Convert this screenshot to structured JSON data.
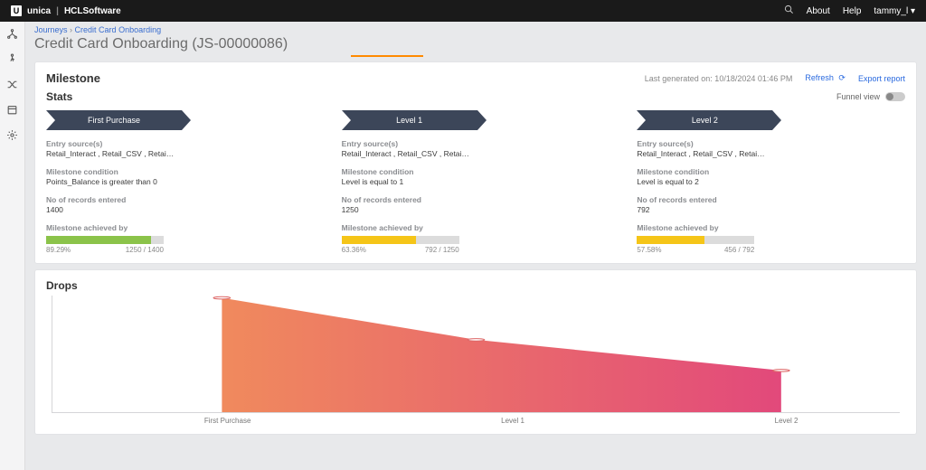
{
  "topbar": {
    "brand_primary": "unica",
    "brand_separator": "|",
    "brand_secondary_bold": "HCL",
    "brand_secondary_light": "Software",
    "links": {
      "about": "About",
      "help": "Help",
      "user": "tammy_l"
    }
  },
  "breadcrumb": {
    "root": "Journeys",
    "current": "Credit Card Onboarding"
  },
  "page": {
    "title": "Credit Card Onboarding (JS-00000086)"
  },
  "milestone": {
    "title": "Milestone",
    "last_generated": "Last generated on: 10/18/2024 01:46 PM",
    "refresh": "Refresh",
    "export": "Export report"
  },
  "stats": {
    "title": "Stats",
    "funnel_label": "Funnel view",
    "columns": [
      {
        "name": "First Purchase",
        "entry_label": "Entry source(s)",
        "entry_value": "Retail_Interact , Retail_CSV , Retai…",
        "condition_label": "Milestone condition",
        "condition_value": "Points_Balance is greater than 0",
        "records_label": "No of records entered",
        "records_value": "1400",
        "achieved_label": "Milestone achieved by",
        "percent": "89.29%",
        "ratio": "1250 / 1400",
        "fill_pct": 89.29,
        "color": "green"
      },
      {
        "name": "Level 1",
        "entry_label": "Entry source(s)",
        "entry_value": "Retail_Interact , Retail_CSV , Retai…",
        "condition_label": "Milestone condition",
        "condition_value": "Level is equal to 1",
        "records_label": "No of records entered",
        "records_value": "1250",
        "achieved_label": "Milestone achieved by",
        "percent": "63.36%",
        "ratio": "792 / 1250",
        "fill_pct": 63.36,
        "color": "yellow"
      },
      {
        "name": "Level 2",
        "entry_label": "Entry source(s)",
        "entry_value": "Retail_Interact , Retail_CSV , Retai…",
        "condition_label": "Milestone condition",
        "condition_value": "Level is equal to 2",
        "records_label": "No of records entered",
        "records_value": "792",
        "achieved_label": "Milestone achieved by",
        "percent": "57.58%",
        "ratio": "456 / 792",
        "fill_pct": 57.58,
        "color": "yellow"
      }
    ]
  },
  "drops": {
    "title": "Drops",
    "series": [
      {
        "label": "First Purchase",
        "value": 1250
      },
      {
        "label": "Level 1",
        "value": 792
      },
      {
        "label": "Level 2",
        "value": 456
      }
    ]
  },
  "chart_data": {
    "type": "area",
    "title": "Drops",
    "categories": [
      "First Purchase",
      "Level 1",
      "Level 2"
    ],
    "values": [
      1250,
      792,
      456
    ],
    "ylim": [
      0,
      1300
    ],
    "xlabel": "",
    "ylabel": ""
  }
}
